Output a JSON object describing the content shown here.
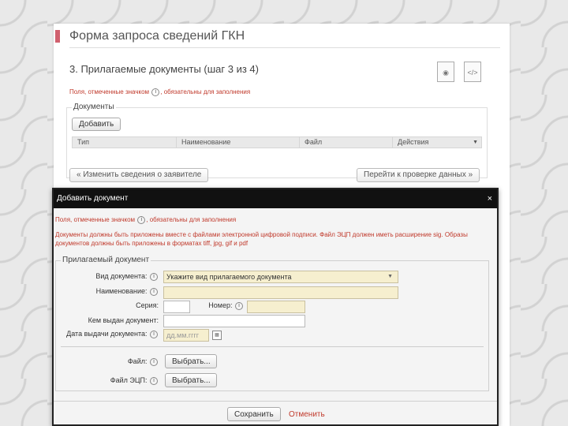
{
  "form": {
    "title": "Форма запроса сведений ГКН",
    "step": "3. Прилагаемые документы (шаг 3 из 4)",
    "note_before": "Поля, отмеченные значком",
    "note_after": ", обязательны для заполнения",
    "info_glyph": "i",
    "icons": [
      "view-icon",
      "xml-icon"
    ],
    "docs_legend": "Документы",
    "add_button": "Добавить",
    "table_columns": [
      "Тип",
      "Наименование",
      "Файл",
      "Действия"
    ],
    "back_button": "« Изменить сведения о заявителе",
    "next_button": "Перейти к проверке данных »"
  },
  "dialog": {
    "title": "Добавить документ",
    "close": "×",
    "note_before": "Поля, отмеченные значком",
    "note_after": ", обязательны для заполнения",
    "signature_note": "Документы должны быть приложены вместе с файлами электронной цифровой подписи. Файл ЭЦП должен иметь расширение sig. Образы документов должны быть приложены в форматах tiff, jpg, gif и pdf",
    "legend": "Прилагаемый документ",
    "doc_type_label": "Вид документа:",
    "doc_type_value": "Укажите вид прилагаемого документа",
    "name_label": "Наименование:",
    "series_label": "Серия:",
    "number_label": "Номер:",
    "issued_by_label": "Кем выдан документ:",
    "issue_date_label": "Дата выдачи документа:",
    "issue_date_placeholder": "дд.мм.гггг",
    "file_label": "Файл:",
    "signature_file_label": "Файл ЭЦП:",
    "choose_button": "Выбрать...",
    "save_button": "Сохранить",
    "cancel_link": "Отменить"
  },
  "colors": {
    "accent": "#d0606e",
    "required_text": "#c0392b",
    "required_field": "#f6efcf",
    "dialog_header": "#111111"
  }
}
